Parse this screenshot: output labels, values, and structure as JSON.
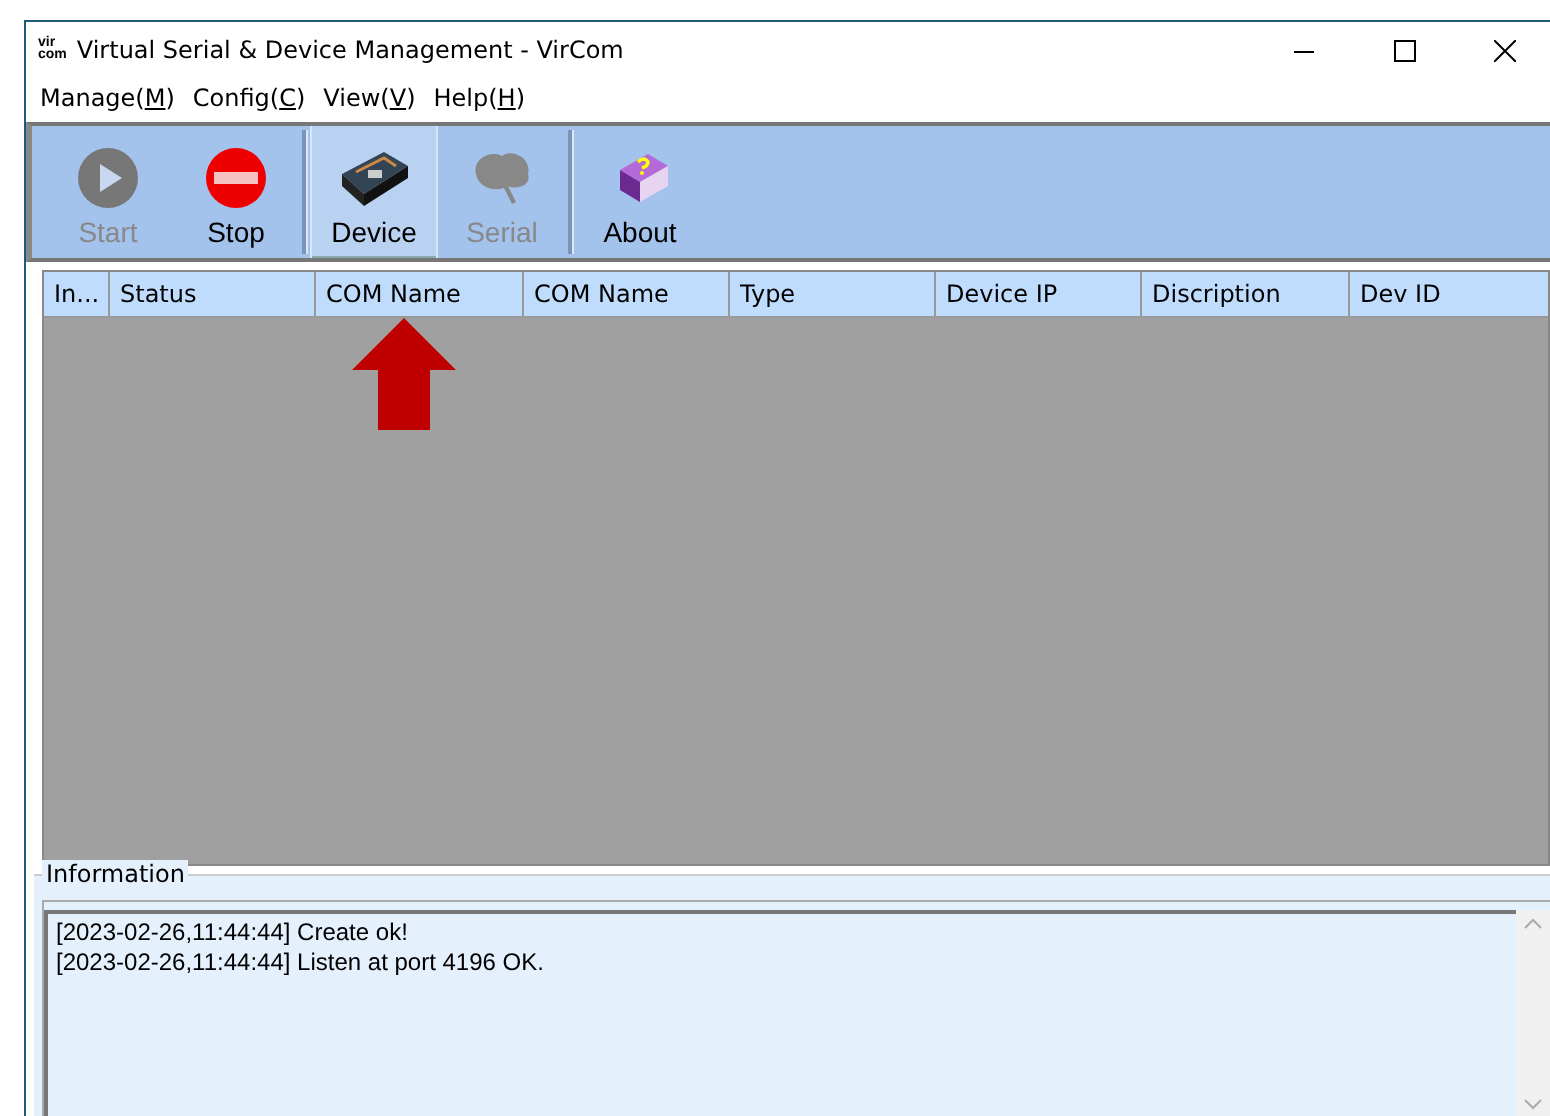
{
  "window": {
    "title": "Virtual Serial & Device Management - VirCom",
    "logo_top": "vir",
    "logo_bottom": "com"
  },
  "menu": [
    {
      "label": "Manage(",
      "key": "M",
      "end": ")"
    },
    {
      "label": "Config(",
      "key": "C",
      "end": ")"
    },
    {
      "label": "View(",
      "key": "V",
      "end": ")"
    },
    {
      "label": "Help(",
      "key": "H",
      "end": ")"
    }
  ],
  "toolbar": [
    {
      "kind": "start",
      "label": "Start",
      "disabled": true,
      "selected": false,
      "separator_after": false
    },
    {
      "kind": "stop",
      "label": "Stop",
      "disabled": false,
      "selected": false,
      "separator_after": true
    },
    {
      "kind": "device",
      "label": "Device",
      "disabled": false,
      "selected": true,
      "separator_after": false
    },
    {
      "kind": "serial",
      "label": "Serial",
      "disabled": true,
      "selected": false,
      "separator_after": true
    },
    {
      "kind": "about",
      "label": "About",
      "disabled": false,
      "selected": false,
      "separator_after": false
    }
  ],
  "table": {
    "columns": [
      "In...",
      "Status",
      "COM Name",
      "COM Name",
      "Type",
      "Device IP",
      "Discription",
      "Dev ID"
    ]
  },
  "information": {
    "title": "Information",
    "lines": [
      "[2023-02-26,11:44:44] Create ok!",
      "[2023-02-26,11:44:44] Listen at port 4196 OK."
    ]
  }
}
